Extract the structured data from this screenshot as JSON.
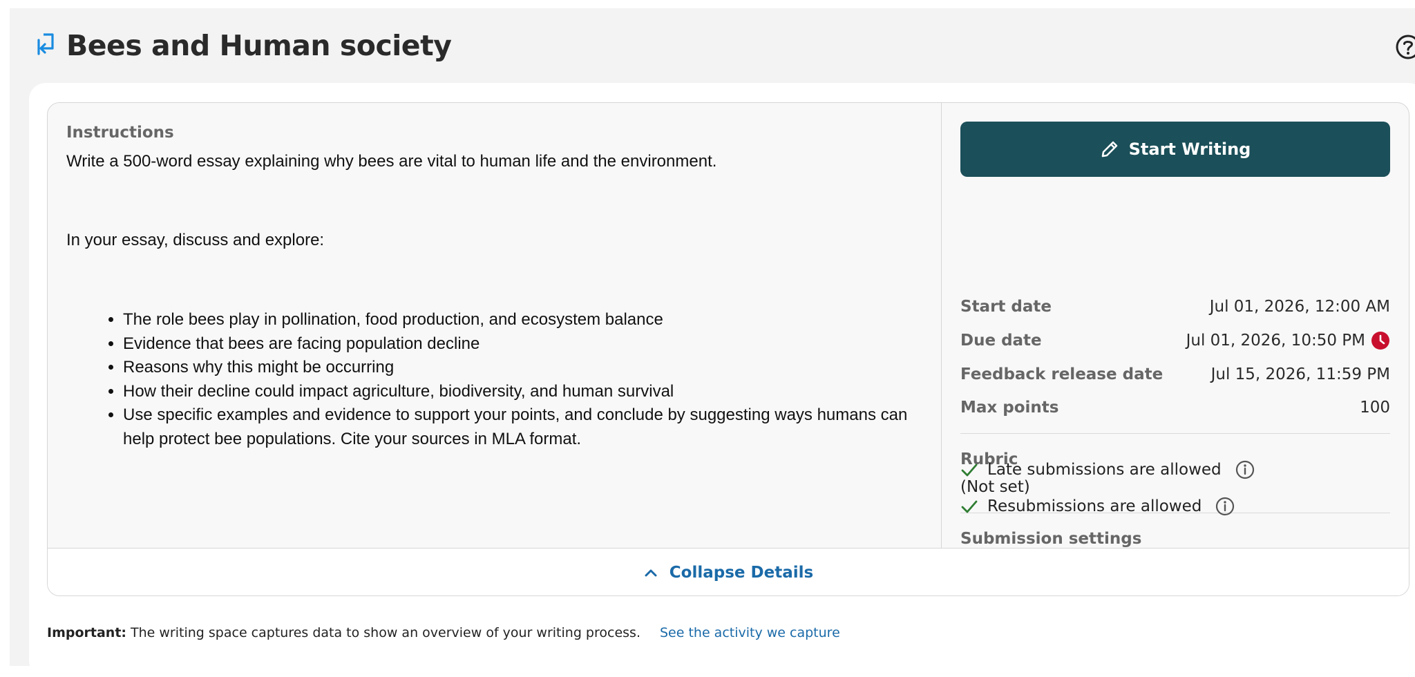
{
  "header": {
    "title": "Bees and Human society"
  },
  "instructions": {
    "label": "Instructions",
    "intro": "Write a 500-word essay explaining why bees are vital to human life and the environment.",
    "prompt": "In your essay, discuss and explore:",
    "bullets": [
      "The role bees play in pollination, food production, and ecosystem balance",
      "Evidence that bees are facing population decline",
      "Reasons why this might be occurring",
      "How their decline could impact agriculture, biodiversity, and human survival",
      "Use specific examples and evidence to support your points, and conclude by suggesting ways humans can help protect bee populations. Cite your sources in MLA format."
    ]
  },
  "sidebar": {
    "start_button": "Start Writing",
    "start_date_label": "Start date",
    "start_date": "Jul 01, 2026, 12:00 AM",
    "due_date_label": "Due date",
    "due_date": "Jul 01, 2026, 10:50 PM",
    "feedback_label": "Feedback release date",
    "feedback_date": "Jul 15, 2026, 11:59 PM",
    "max_points_label": "Max points",
    "max_points": "100",
    "rubric_label": "Rubric",
    "rubric_value": "(Not set)",
    "submission_label": "Submission settings",
    "late_text": "Late submissions are allowed",
    "resub_text": "Resubmissions are allowed"
  },
  "footer": {
    "collapse_label": "Collapse Details"
  },
  "note": {
    "bold": "Important:",
    "text": "The writing space captures data to show an overview of your writing process.",
    "link": "See the activity we capture"
  },
  "colors": {
    "primary_button": "#1b4f59",
    "link": "#1a6aa8",
    "due_alert": "#c8102e",
    "check": "#2e7d32"
  },
  "icons": {
    "title": "assignment-icon",
    "help": "help-icon",
    "pencil": "pencil-icon",
    "clock": "clock-icon",
    "check": "check-icon",
    "info": "info-icon",
    "chevron": "chevron-up-icon"
  }
}
